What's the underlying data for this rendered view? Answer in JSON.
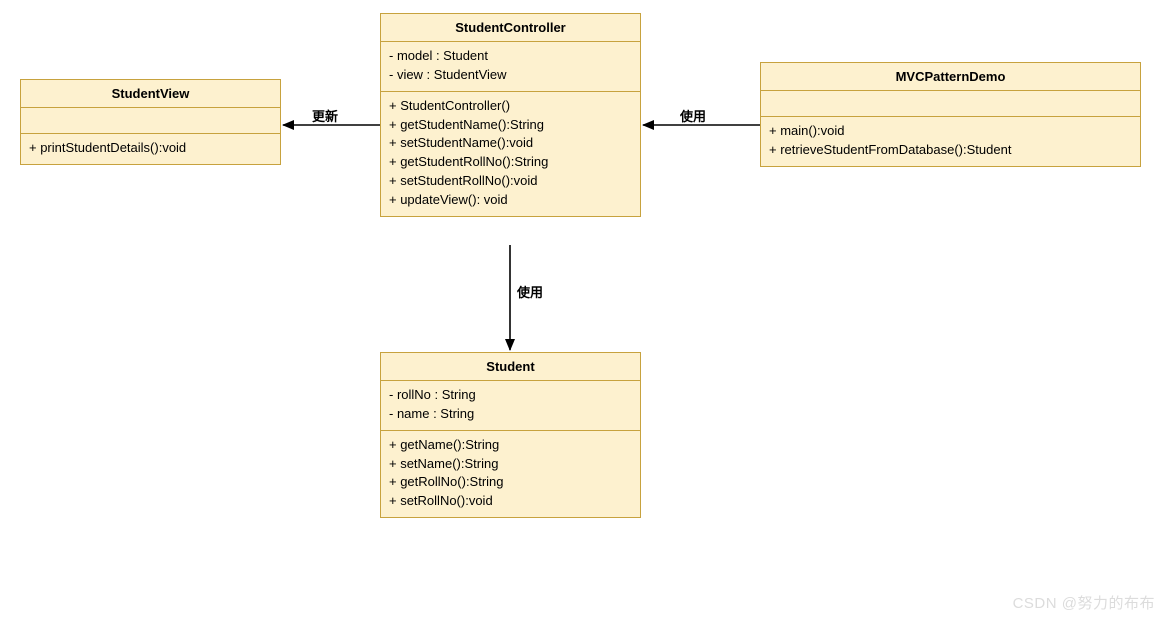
{
  "classes": {
    "studentView": {
      "title": "StudentView",
      "attrs": [],
      "methods": [
        "+ printStudentDetails():void"
      ]
    },
    "studentController": {
      "title": "StudentController",
      "attrs": [
        "- model : Student",
        "- view : StudentView"
      ],
      "methods": [
        "+ StudentController()",
        "+ getStudentName():String",
        "+ setStudentName():void",
        "+ getStudentRollNo():String",
        "+ setStudentRollNo():void",
        "+ updateView(): void"
      ]
    },
    "mvcPatternDemo": {
      "title": "MVCPatternDemo",
      "attrs": [],
      "methods": [
        "+ main():void",
        "+ retrieveStudentFromDatabase():Student"
      ]
    },
    "student": {
      "title": "Student",
      "attrs": [
        "- rollNo : String",
        "- name : String"
      ],
      "methods": [
        "+ getName():String",
        "+ setName():String",
        "+ getRollNo():String",
        "+ setRollNo():void"
      ]
    }
  },
  "edges": {
    "update": "更新",
    "use1": "使用",
    "use2": "使用"
  },
  "watermark": "CSDN @努力的布布"
}
